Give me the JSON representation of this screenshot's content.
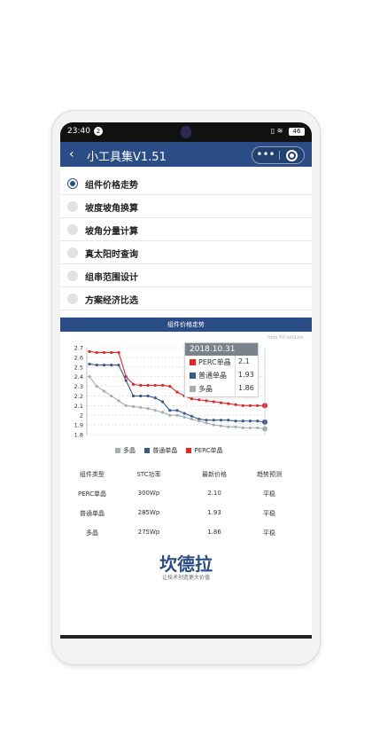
{
  "status": {
    "time": "23:40",
    "notif": "2",
    "battery": "46"
  },
  "nav": {
    "title": "小工具集V1.51"
  },
  "menu": [
    {
      "label": "组件价格走势"
    },
    {
      "label": "坡度坡角换算"
    },
    {
      "label": "坡角分量计算"
    },
    {
      "label": "真太阳时查询"
    },
    {
      "label": "组串范围设计"
    },
    {
      "label": "方案经济比选"
    }
  ],
  "section": {
    "title": "组件价格走势",
    "source": "from PV InfoLink"
  },
  "tooltip": {
    "date": "2018.10.31",
    "rows": [
      {
        "name": "PERC单晶",
        "value": "2.1",
        "color": "#e32626"
      },
      {
        "name": "普通单晶",
        "value": "1.93",
        "color": "#3a5a8c"
      },
      {
        "name": "多晶",
        "value": "1.86",
        "color": "#a6acb6"
      }
    ]
  },
  "legend": [
    {
      "name": "多晶",
      "color": "#a6acb6"
    },
    {
      "name": "普通单晶",
      "color": "#3a5a8c"
    },
    {
      "name": "PERC单晶",
      "color": "#e32626"
    }
  ],
  "chart_data": {
    "type": "line",
    "ylim": [
      1.8,
      2.7
    ],
    "yticks": [
      "2.7",
      "2.6",
      "2.5",
      "2.4",
      "2.3",
      "2.2",
      "2.1",
      "2",
      "1.9",
      "1.8"
    ],
    "grid": true,
    "legend_position": "bottom",
    "series": [
      {
        "name": "PERC单晶",
        "color": "#e32626",
        "values": [
          2.66,
          2.65,
          2.65,
          2.65,
          2.65,
          2.4,
          2.32,
          2.31,
          2.31,
          2.31,
          2.31,
          2.3,
          2.24,
          2.2,
          2.17,
          2.16,
          2.15,
          2.14,
          2.13,
          2.12,
          2.11,
          2.1,
          2.1,
          2.1,
          2.1
        ]
      },
      {
        "name": "普通单晶",
        "color": "#3a5a8c",
        "values": [
          2.53,
          2.52,
          2.52,
          2.52,
          2.52,
          2.36,
          2.2,
          2.2,
          2.2,
          2.18,
          2.14,
          2.05,
          2.05,
          2.02,
          1.99,
          1.96,
          1.95,
          1.95,
          1.95,
          1.95,
          1.94,
          1.94,
          1.94,
          1.94,
          1.93
        ]
      },
      {
        "name": "多晶",
        "color": "#a6acb6",
        "values": [
          2.4,
          2.3,
          2.25,
          2.2,
          2.15,
          2.1,
          2.09,
          2.08,
          2.07,
          2.05,
          2.03,
          2.0,
          2.0,
          1.98,
          1.96,
          1.94,
          1.92,
          1.9,
          1.89,
          1.88,
          1.88,
          1.87,
          1.87,
          1.87,
          1.86
        ]
      }
    ]
  },
  "table": {
    "headers": [
      "组件类型",
      "STC功率",
      "最新价格",
      "趋势预测"
    ],
    "rows": [
      [
        "PERC单晶",
        "300Wp",
        "2.10",
        "平稳"
      ],
      [
        "普通单晶",
        "285Wp",
        "1.93",
        "平稳"
      ],
      [
        "多晶",
        "275Wp",
        "1.86",
        "平稳"
      ]
    ]
  },
  "brand": {
    "name": "坎德拉",
    "slogan": "让技术创造更大价值"
  }
}
